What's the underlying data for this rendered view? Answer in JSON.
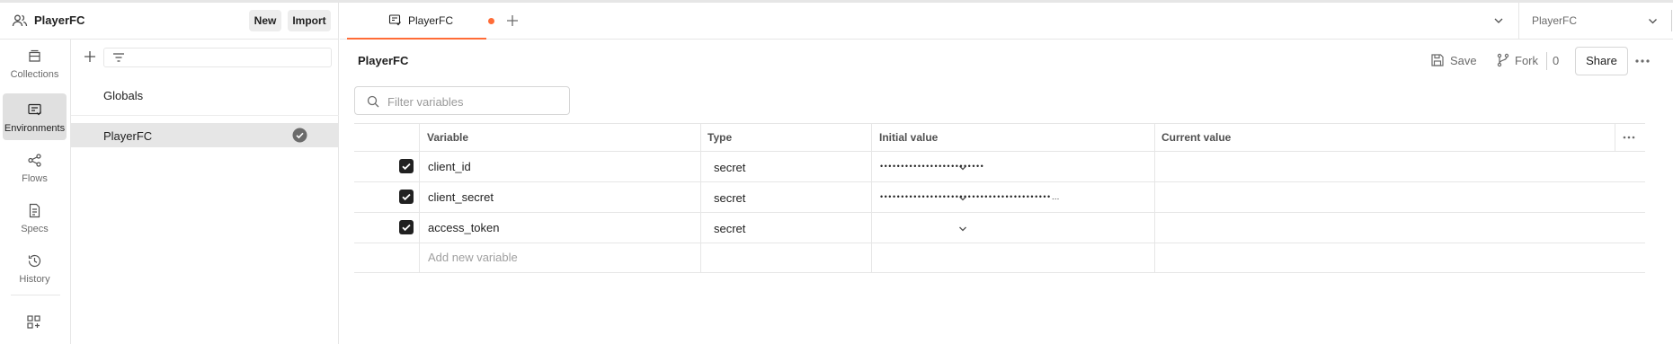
{
  "workspace": {
    "name": "PlayerFC",
    "new_label": "New",
    "import_label": "Import"
  },
  "rail": {
    "items": [
      {
        "label": "Collections",
        "icon": "collections-icon"
      },
      {
        "label": "Environments",
        "icon": "environments-icon",
        "active": true
      },
      {
        "label": "Flows",
        "icon": "flows-icon"
      },
      {
        "label": "Specs",
        "icon": "specs-icon"
      },
      {
        "label": "History",
        "icon": "history-icon"
      }
    ],
    "bottom_icon": "configure-workbench-icon"
  },
  "sidebar": {
    "items": [
      {
        "label": "Globals"
      },
      {
        "label": "PlayerFC",
        "selected": true,
        "active_icon": "check-circle-icon"
      }
    ]
  },
  "tabs": [
    {
      "label": "PlayerFC",
      "unsaved": true
    }
  ],
  "environment_selector": {
    "value": "PlayerFC"
  },
  "main": {
    "title": "PlayerFC",
    "save_label": "Save",
    "fork_label": "Fork",
    "fork_count": "0",
    "share_label": "Share",
    "filter_placeholder": "Filter variables"
  },
  "table": {
    "columns": [
      "Variable",
      "Type",
      "Initial value",
      "Current value"
    ],
    "rows": [
      {
        "checked": true,
        "variable": "client_id",
        "type": "secret",
        "initial_value": "•••••••••••••••••••••••••",
        "current_value": ""
      },
      {
        "checked": true,
        "variable": "client_secret",
        "type": "secret",
        "initial_value": "•••••••••••••••••••••••••••••••••••••••••…",
        "current_value": ""
      },
      {
        "checked": true,
        "variable": "access_token",
        "type": "secret",
        "initial_value": "",
        "current_value": ""
      }
    ],
    "new_row_placeholder": "Add new variable"
  },
  "colors": {
    "accent": "#ff6c37",
    "active_rail_bg": "#e0e0e0",
    "selected_item_bg": "#e6e6e6",
    "checkbox": "#212121",
    "border": "#e6e6e6"
  }
}
